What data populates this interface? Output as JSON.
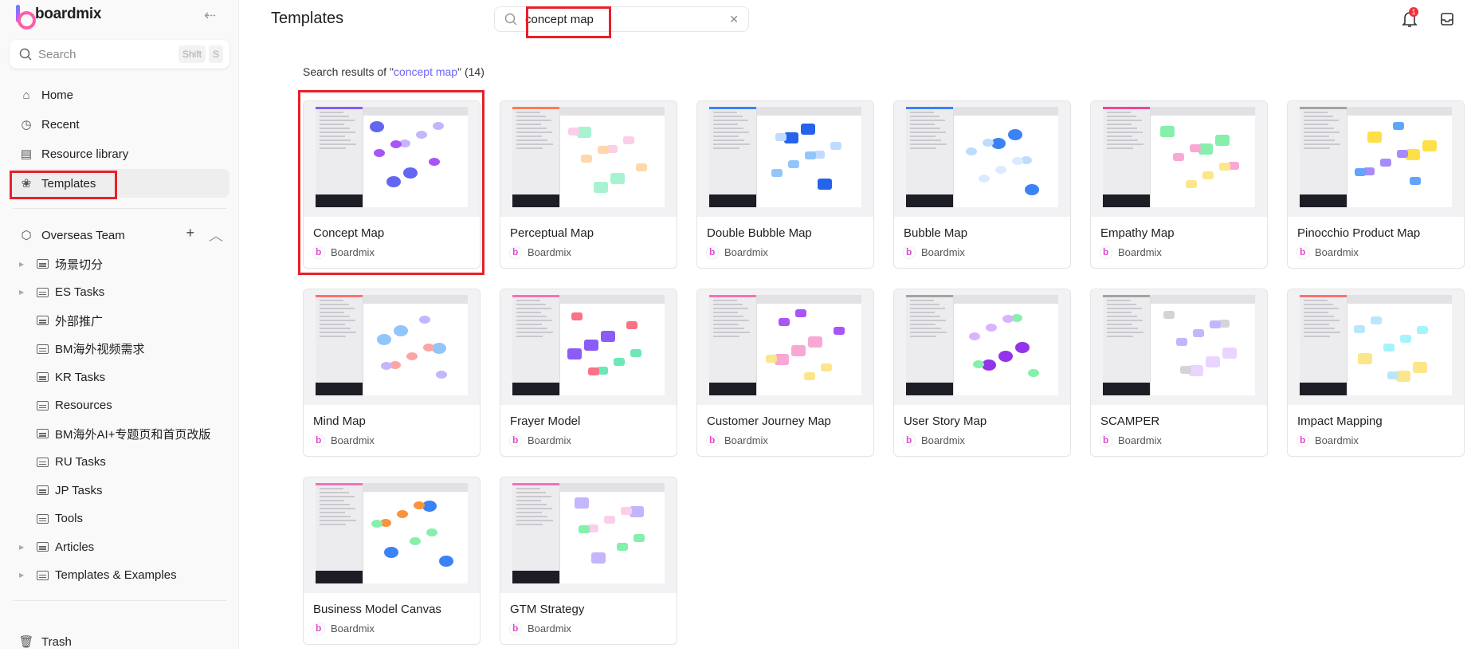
{
  "app": {
    "name": "boardmix"
  },
  "sidebar": {
    "search_placeholder": "Search",
    "shortcut": [
      "Shift",
      "S"
    ],
    "nav": [
      {
        "label": "Home",
        "icon": "home-icon"
      },
      {
        "label": "Recent",
        "icon": "clock-icon"
      },
      {
        "label": "Resource library",
        "icon": "library-icon"
      },
      {
        "label": "Templates",
        "icon": "templates-icon",
        "active": true
      }
    ],
    "team": {
      "label": "Overseas Team"
    },
    "tree": [
      {
        "label": "场景切分",
        "expandable": true
      },
      {
        "label": "ES Tasks",
        "expandable": true
      },
      {
        "label": "外部推广",
        "expandable": false
      },
      {
        "label": "BM海外视频需求",
        "expandable": false
      },
      {
        "label": "KR Tasks",
        "expandable": false
      },
      {
        "label": "Resources",
        "expandable": false
      },
      {
        "label": "BM海外AI+专题页和首页改版",
        "expandable": false
      },
      {
        "label": "RU Tasks",
        "expandable": false
      },
      {
        "label": "JP Tasks",
        "expandable": false
      },
      {
        "label": "Tools",
        "expandable": false
      },
      {
        "label": "Articles",
        "expandable": true
      },
      {
        "label": "Templates & Examples",
        "expandable": true
      }
    ],
    "trash": "Trash"
  },
  "header": {
    "title": "Templates",
    "search_value": "concept map",
    "notification_count": "1"
  },
  "results": {
    "prefix": "Search results of \"",
    "query": "concept map",
    "suffix": "\" (14)"
  },
  "colors": {
    "highlight": "#e8202a",
    "accent": "#6c63ff"
  },
  "templates": [
    {
      "title": "Concept Map",
      "author": "Boardmix",
      "accent": "#8b5cf6",
      "palette": [
        "#6366f1",
        "#c4b5fd",
        "#a855f7"
      ],
      "selected": true
    },
    {
      "title": "Perceptual Map",
      "author": "Boardmix",
      "accent": "#ff7a59",
      "palette": [
        "#a7f3d0",
        "#fbcfe8",
        "#fed7aa"
      ]
    },
    {
      "title": "Double Bubble Map",
      "author": "Boardmix",
      "accent": "#3b82f6",
      "palette": [
        "#2563eb",
        "#bfdbfe",
        "#93c5fd"
      ]
    },
    {
      "title": "Bubble Map",
      "author": "Boardmix",
      "accent": "#3b82f6",
      "palette": [
        "#3b82f6",
        "#bfdbfe",
        "#dbeafe"
      ]
    },
    {
      "title": "Empathy Map",
      "author": "Boardmix",
      "accent": "#ec4899",
      "palette": [
        "#86efac",
        "#f9a8d4",
        "#fde68a"
      ]
    },
    {
      "title": "Pinocchio Product Map",
      "author": "Boardmix",
      "accent": "#a3a3a3",
      "palette": [
        "#fde047",
        "#a78bfa",
        "#60a5fa"
      ]
    },
    {
      "title": "Mind Map",
      "author": "Boardmix",
      "accent": "#f87171",
      "palette": [
        "#93c5fd",
        "#fca5a5",
        "#c4b5fd"
      ]
    },
    {
      "title": "Frayer Model",
      "author": "Boardmix",
      "accent": "#f472b6",
      "palette": [
        "#8b5cf6",
        "#6ee7b7",
        "#fb7185"
      ]
    },
    {
      "title": "Customer Journey Map",
      "author": "Boardmix",
      "accent": "#f472b6",
      "palette": [
        "#f9a8d4",
        "#fde68a",
        "#a855f7"
      ]
    },
    {
      "title": "User Story Map",
      "author": "Boardmix",
      "accent": "#a3a3a3",
      "palette": [
        "#9333ea",
        "#86efac",
        "#d8b4fe"
      ]
    },
    {
      "title": "SCAMPER",
      "author": "Boardmix",
      "accent": "#a3a3a3",
      "palette": [
        "#e9d5ff",
        "#d4d4d8",
        "#c4b5fd"
      ]
    },
    {
      "title": "Impact Mapping",
      "author": "Boardmix",
      "accent": "#f87171",
      "palette": [
        "#fde68a",
        "#bae6fd",
        "#a5f3fc"
      ]
    },
    {
      "title": "Business Model Canvas",
      "author": "Boardmix",
      "accent": "#f472b6",
      "palette": [
        "#3b82f6",
        "#fb923c",
        "#86efac"
      ]
    },
    {
      "title": "GTM Strategy",
      "author": "Boardmix",
      "accent": "#f472b6",
      "palette": [
        "#c4b5fd",
        "#fbcfe8",
        "#86efac"
      ]
    }
  ]
}
